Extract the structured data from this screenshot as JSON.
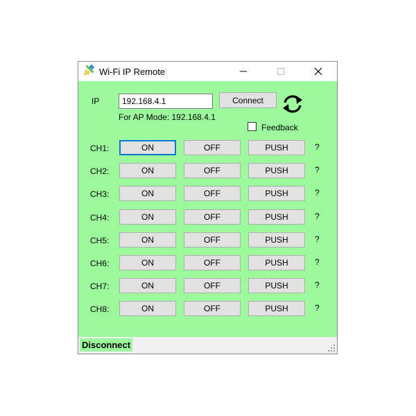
{
  "window": {
    "title": "Wi-Fi IP Remote",
    "controls": {
      "minimize": "—",
      "maximize": "☐",
      "close": "✕"
    }
  },
  "connection": {
    "ip_label": "IP",
    "ip_value": "192.168.4.1",
    "connect_label": "Connect",
    "ap_mode_text": "For AP Mode: 192.168.4.1",
    "feedback_label": "Feedback",
    "feedback_checked": false
  },
  "channels": [
    {
      "label": "CH1:",
      "on": "ON",
      "off": "OFF",
      "push": "PUSH",
      "status": "?"
    },
    {
      "label": "CH2:",
      "on": "ON",
      "off": "OFF",
      "push": "PUSH",
      "status": "?"
    },
    {
      "label": "CH3:",
      "on": "ON",
      "off": "OFF",
      "push": "PUSH",
      "status": "?"
    },
    {
      "label": "CH4:",
      "on": "ON",
      "off": "OFF",
      "push": "PUSH",
      "status": "?"
    },
    {
      "label": "CH5:",
      "on": "ON",
      "off": "OFF",
      "push": "PUSH",
      "status": "?"
    },
    {
      "label": "CH6:",
      "on": "ON",
      "off": "OFF",
      "push": "PUSH",
      "status": "?"
    },
    {
      "label": "CH7:",
      "on": "ON",
      "off": "OFF",
      "push": "PUSH",
      "status": "?"
    },
    {
      "label": "CH8:",
      "on": "ON",
      "off": "OFF",
      "push": "PUSH",
      "status": "?"
    }
  ],
  "status_bar": {
    "text": "Disconnect"
  },
  "colors": {
    "background": "#9cfa9c",
    "focus": "#0078d7"
  },
  "icons": {
    "app": "pencil-icon",
    "refresh": "refresh-icon"
  }
}
